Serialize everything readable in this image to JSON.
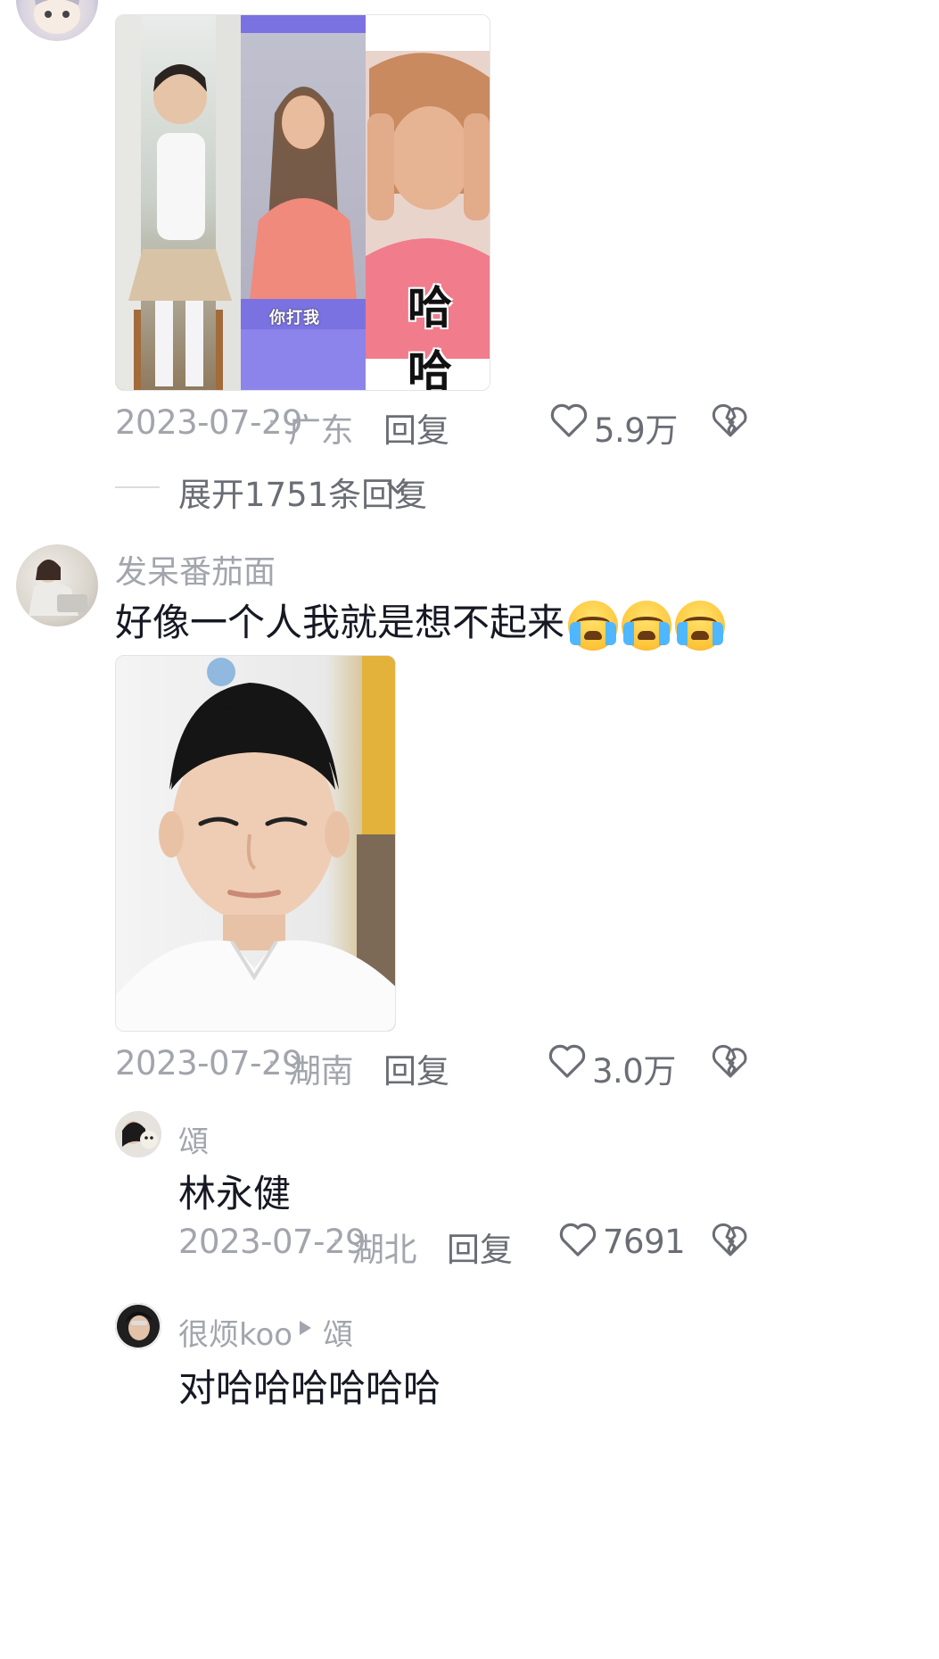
{
  "comment1": {
    "images_caption_mid": "你打我",
    "images_caption_right": "哈哈",
    "date": "2023-07-29",
    "location": "广东",
    "reply_label": "回复",
    "likes": "5.9万",
    "expand_label": "展开1751条回复"
  },
  "comment2": {
    "username": "发呆番茄面",
    "text": "好像一个人我就是想不起来",
    "emoji_names": [
      "crying-emoji",
      "crying-emoji",
      "crying-emoji"
    ],
    "date": "2023-07-29",
    "location": "湖南",
    "reply_label": "回复",
    "likes": "3.0万"
  },
  "reply1": {
    "username": "頌",
    "text": "林永健",
    "date": "2023-07-29",
    "location": "湖北",
    "reply_label": "回复",
    "likes": "7691"
  },
  "reply2": {
    "username": "很烦koo",
    "reply_to": "頌",
    "text": "对哈哈哈哈哈哈"
  },
  "colors": {
    "meta_gray": "#a3a5ad",
    "text_dark": "#161823",
    "caption_purple": "#7a72e0"
  }
}
